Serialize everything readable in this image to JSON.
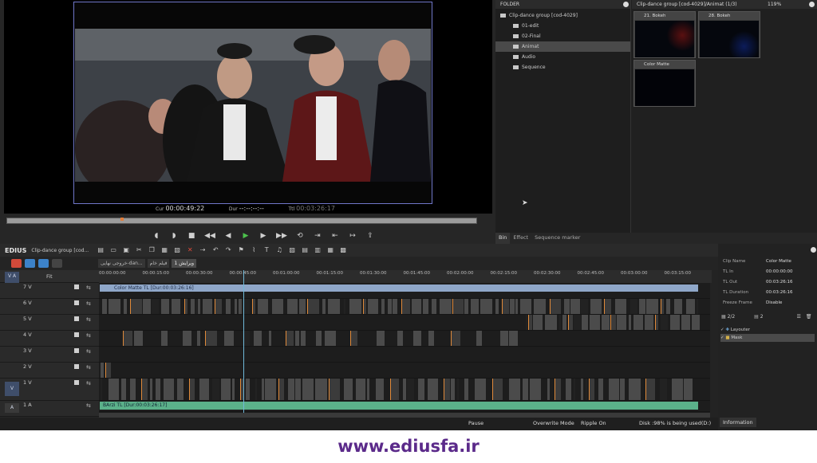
{
  "preview": {
    "cur_label": "Cur",
    "cur_value": "00:00:49:22",
    "dur_label": "Dur",
    "dur_value": "--:--:--:--",
    "ttl_label": "Ttl",
    "ttl_value": "00:03:26:17"
  },
  "bin": {
    "folder_header": "FOLDER",
    "path_header": "Clip-dance group [cod-4029]/Animat (1/3)",
    "zoom": "119%",
    "tree": [
      {
        "label": "Clip-dance group [cod-4029]",
        "selected": false
      },
      {
        "label": "01-edit",
        "selected": false
      },
      {
        "label": "02-Final",
        "selected": false
      },
      {
        "label": "Animat",
        "selected": true
      },
      {
        "label": "Audio",
        "selected": false
      },
      {
        "label": "Sequence",
        "selected": false
      }
    ],
    "clips": [
      {
        "label": "21. Bokeh"
      },
      {
        "label": "28. Bokeh"
      },
      {
        "label": "Color Matte"
      }
    ],
    "tabs": [
      "Bin",
      "Effect",
      "Sequence marker"
    ]
  },
  "timeline": {
    "brand": "EDIUS",
    "project": "Clip-dance group [cod...",
    "fit_label": "Fit",
    "seq_tabs": [
      "خروجی نهایی-dan...",
      "فیلم خام",
      "ویرایش 1"
    ],
    "ruler": [
      "00:00:00:00",
      "00:00:15:00",
      "00:00:30:00",
      "00:00:45:00",
      "00:01:00:00",
      "00:01:15:00",
      "00:01:30:00",
      "00:01:45:00",
      "00:02:00:00",
      "00:02:15:00",
      "00:02:30:00",
      "00:02:45:00",
      "00:03:00:00",
      "00:03:15:00"
    ],
    "tracks": [
      "7 V",
      "6 V",
      "5 V",
      "4 V",
      "3 V",
      "2 V",
      "1 V",
      "1 A"
    ],
    "track_side": [
      "V A",
      "",
      "",
      "",
      "",
      "",
      "V",
      "A"
    ],
    "matte_label": "Color Matte  TL [Dur:00:03:26:16]",
    "audio_label": "BArzi  TL [Dur:00:03:26:17]",
    "status": {
      "pause": "Pause",
      "mode": "Overwrite Mode",
      "ripple": "Ripple On",
      "disk": "Disk :98% is being used(D:)"
    }
  },
  "info": {
    "rows": [
      {
        "k": "Clip Name",
        "v": "Color Matte"
      },
      {
        "k": "TL In",
        "v": "00:00:00:00"
      },
      {
        "k": "TL Out",
        "v": "00:03:26:16"
      },
      {
        "k": "TL Duration",
        "v": "00:03:26:16"
      },
      {
        "k": "Freeze Frame",
        "v": "Disable"
      }
    ],
    "count_a": "2/2",
    "count_b": "2",
    "layers": [
      {
        "label": "Layouter",
        "selected": false
      },
      {
        "label": "Mask",
        "selected": true
      }
    ],
    "tab": "Information"
  },
  "watermark": "www.ediusfa.ir",
  "colors": {
    "accent": "#6fb8d8",
    "matte": "#8fa7c9",
    "audio": "#5bb18a",
    "watermark": "#5b2a8a"
  }
}
